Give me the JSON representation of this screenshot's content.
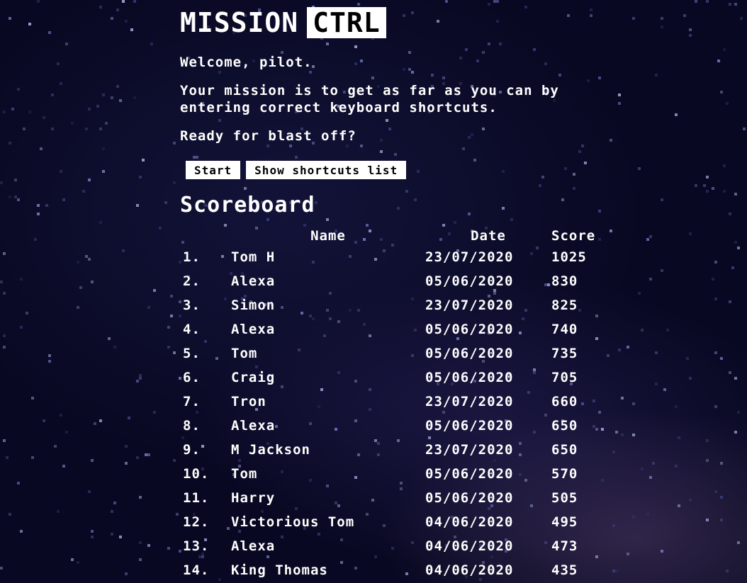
{
  "logo": {
    "left": "MISSION",
    "right": "CTRL"
  },
  "intro": {
    "welcome": "Welcome, pilot.",
    "mission": "Your mission is to get as far as you can by\nentering correct keyboard shortcuts.",
    "ready": "Ready for blast off?"
  },
  "buttons": {
    "start": "Start",
    "shortcuts": "Show shortcuts list"
  },
  "scoreboard": {
    "title": "Scoreboard",
    "headers": {
      "rank": "",
      "name": "Name",
      "date": "Date",
      "score": "Score"
    },
    "rows": [
      {
        "rank": "1.",
        "name": "Tom H",
        "date": "23/07/2020",
        "score": "1025"
      },
      {
        "rank": "2.",
        "name": "Alexa",
        "date": "05/06/2020",
        "score": "830"
      },
      {
        "rank": "3.",
        "name": "Simon",
        "date": "23/07/2020",
        "score": "825"
      },
      {
        "rank": "4.",
        "name": "Alexa",
        "date": "05/06/2020",
        "score": "740"
      },
      {
        "rank": "5.",
        "name": "Tom",
        "date": "05/06/2020",
        "score": "735"
      },
      {
        "rank": "6.",
        "name": "Craig",
        "date": "05/06/2020",
        "score": "705"
      },
      {
        "rank": "7.",
        "name": "Tron",
        "date": "23/07/2020",
        "score": "660"
      },
      {
        "rank": "8.",
        "name": "Alexa",
        "date": "05/06/2020",
        "score": "650"
      },
      {
        "rank": "9.",
        "name": "M Jackson",
        "date": "23/07/2020",
        "score": "650"
      },
      {
        "rank": "10.",
        "name": "Tom",
        "date": "05/06/2020",
        "score": "570"
      },
      {
        "rank": "11.",
        "name": "Harry",
        "date": "05/06/2020",
        "score": "505"
      },
      {
        "rank": "12.",
        "name": "Victorious Tom",
        "date": "04/06/2020",
        "score": "495"
      },
      {
        "rank": "13.",
        "name": "Alexa",
        "date": "04/06/2020",
        "score": "473"
      },
      {
        "rank": "14.",
        "name": "King Thomas",
        "date": "04/06/2020",
        "score": "435"
      }
    ]
  },
  "colors": {
    "background": "#080822",
    "text": "#ffffff",
    "button_bg": "#ffffff",
    "button_text": "#000000"
  }
}
